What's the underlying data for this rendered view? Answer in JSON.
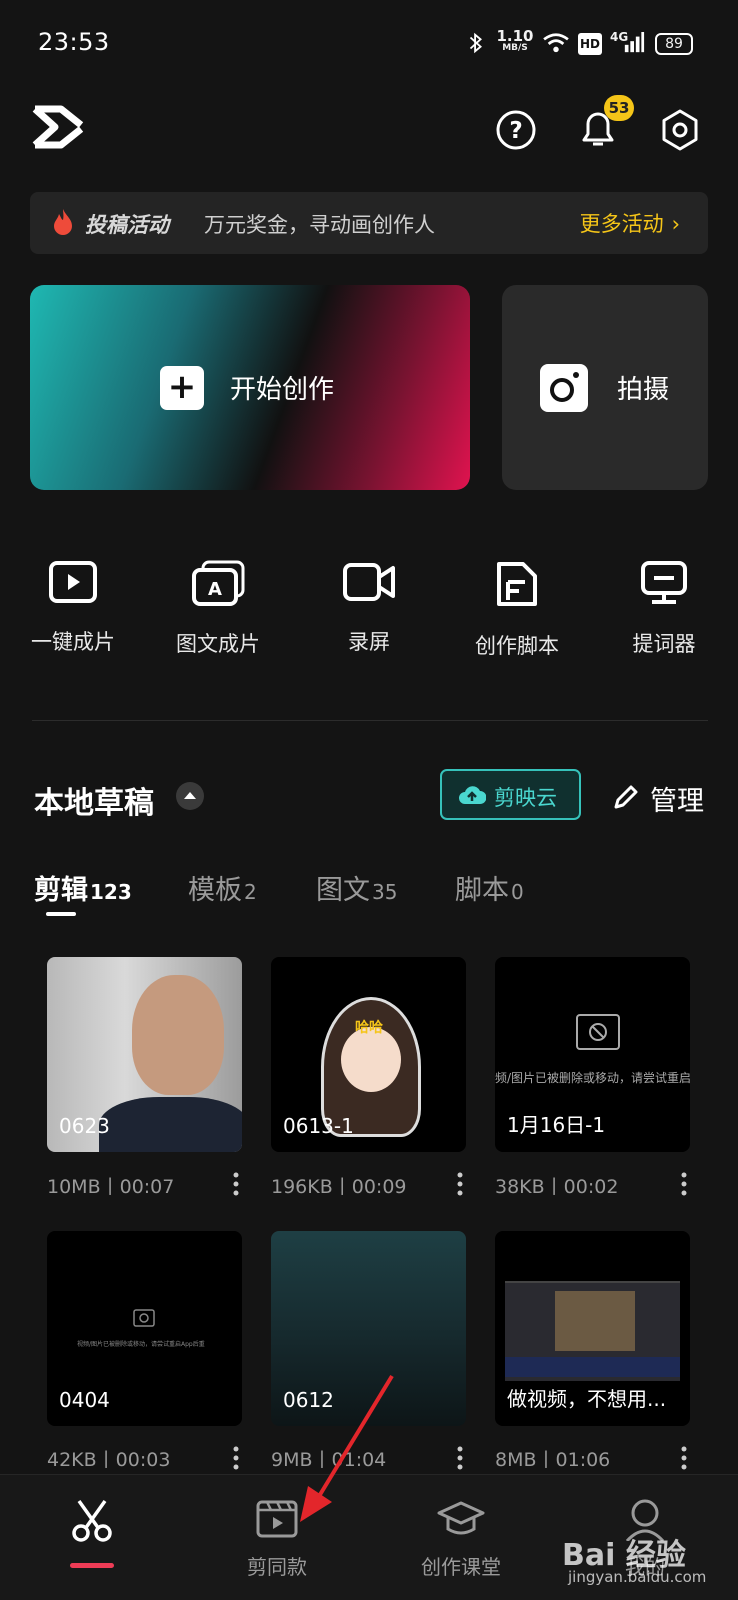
{
  "status_bar": {
    "time": "23:53",
    "net_speed": "1.10",
    "net_unit": "MB/S",
    "hd": "HD",
    "network": "4G",
    "battery": "89",
    "icons": [
      "bluetooth-icon",
      "wifi-icon",
      "signal-icon",
      "battery-icon"
    ]
  },
  "header": {
    "notification_count": "53",
    "icons": [
      "capcut-logo",
      "help-icon",
      "bell-icon",
      "settings-icon"
    ]
  },
  "banner": {
    "tag": "投稿活动",
    "text": "万元奖金，寻动画创作人",
    "more": "更多活动",
    "accent": "#f5c518"
  },
  "cards": {
    "start": "开始创作",
    "shoot": "拍摄"
  },
  "tools": [
    {
      "label": "一键成片",
      "icon": "play-frame-icon"
    },
    {
      "label": "图文成片",
      "icon": "text-to-video-icon"
    },
    {
      "label": "录屏",
      "icon": "screen-record-icon"
    },
    {
      "label": "创作脚本",
      "icon": "script-icon"
    },
    {
      "label": "提词器",
      "icon": "teleprompter-icon"
    }
  ],
  "drafts": {
    "title": "本地草稿",
    "cloud": "剪映云",
    "manage": "管理",
    "tabs": [
      {
        "label": "剪辑",
        "count": "123"
      },
      {
        "label": "模板",
        "count": "2"
      },
      {
        "label": "图文",
        "count": "35"
      },
      {
        "label": "脚本",
        "count": "0"
      }
    ],
    "items": [
      {
        "name": "0623",
        "meta": "10MB丨00:07"
      },
      {
        "name": "0613-1",
        "meta": "196KB丨00:09",
        "sticker": "哈哈"
      },
      {
        "name": "1月16日-1",
        "meta": "38KB丨00:02",
        "notice": "频/图片已被删除或移动，请尝试重启App"
      },
      {
        "name": "0404",
        "meta": "42KB丨00:03",
        "notice": "视频/图片已被删除或移动，请尝试重启App后重"
      },
      {
        "name": "0612",
        "meta": "9MB丨01:04"
      },
      {
        "name": "做视频，不想用...",
        "meta": "8MB丨01:06"
      }
    ]
  },
  "bottom_nav": {
    "items": [
      {
        "label": "",
        "icon": "scissors-icon"
      },
      {
        "label": "剪同款",
        "icon": "template-play-icon"
      },
      {
        "label": "创作课堂",
        "icon": "graduation-cap-icon"
      },
      {
        "label": "我的",
        "icon": "profile-icon"
      }
    ],
    "active_color": "#ee3c56"
  },
  "watermark": {
    "logo": "Bai 经验",
    "url": "jingyan.baidu.com"
  }
}
